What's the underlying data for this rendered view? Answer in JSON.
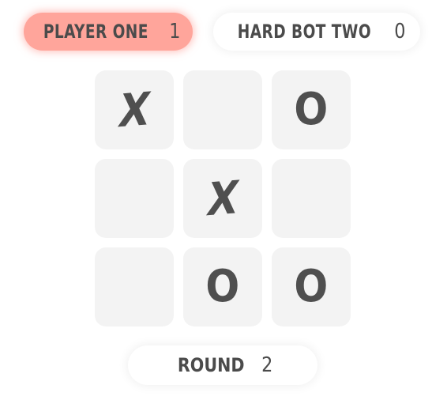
{
  "scoreboard": {
    "player_one": {
      "name": "PLAYER ONE",
      "score": "1",
      "active": true
    },
    "player_two": {
      "name": "HARD BOT TWO",
      "score": "0",
      "active": false
    }
  },
  "board": {
    "cells": [
      "X",
      "",
      "O",
      "",
      "X",
      "",
      "",
      "O",
      "O"
    ]
  },
  "round": {
    "label": "ROUND",
    "value": "2"
  },
  "colors": {
    "active_pill": "#ffa59b",
    "cell_background": "#f3f3f3",
    "mark": "#4f4f4f",
    "text": "#4b4b4b"
  }
}
